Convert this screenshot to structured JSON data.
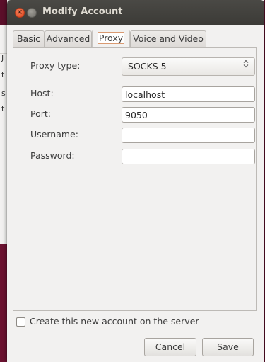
{
  "window": {
    "title": "Modify Account",
    "close_glyph": "×"
  },
  "background_window": {
    "chars": [
      "J",
      "t",
      "s",
      "t"
    ]
  },
  "tabs": [
    {
      "label": "Basic",
      "active": false
    },
    {
      "label": "Advanced",
      "active": false
    },
    {
      "label": "Proxy",
      "active": true
    },
    {
      "label": "Voice and Video",
      "active": false
    }
  ],
  "proxy": {
    "type_label": "Proxy type:",
    "type_value": "SOCKS 5",
    "type_arrow": "⌃⌄",
    "host_label": "Host:",
    "host_value": "localhost",
    "port_label": "Port:",
    "port_value": "9050",
    "username_label": "Username:",
    "username_value": "",
    "password_label": "Password:",
    "password_value": ""
  },
  "footer": {
    "create_account_label": "Create this new account on the server",
    "create_account_checked": false,
    "cancel_label": "Cancel",
    "save_label": "Save"
  },
  "colors": {
    "desktop_bg": "#5b0f2a",
    "titlebar": "#3c3b37",
    "close_button": "#e2532c",
    "active_tab_focus": "#d99a71"
  },
  "icons": {
    "close": "close-icon",
    "minimize": "minimize-icon",
    "combo_arrows": "up-down-chevron-icon"
  }
}
